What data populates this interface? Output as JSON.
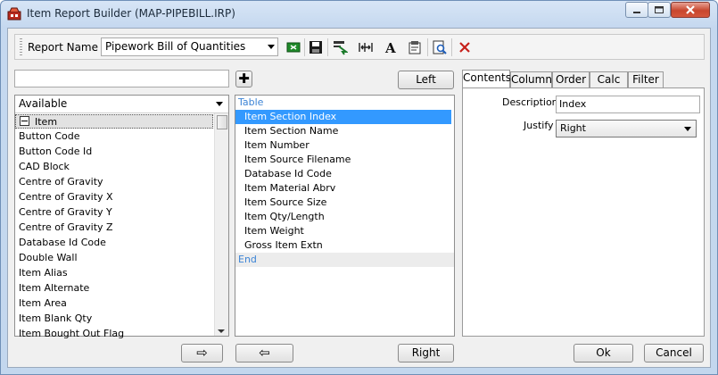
{
  "window": {
    "title": "Item Report Builder (MAP-PIPEBILL.IRP)"
  },
  "toolbar": {
    "report_name_label": "Report Name",
    "report_name_value": "Pipework Bill of Quantities",
    "icons": [
      "export-excel-icon",
      "save-icon",
      "select-icon",
      "column-width-icon",
      "font-icon",
      "properties-icon",
      "preview-icon",
      "delete-icon"
    ]
  },
  "left": {
    "filter_value": "",
    "dropdown_value": "Available",
    "items": [
      "Item",
      "Button Code",
      "Button Code Id",
      "CAD Block",
      "Centre of Gravity",
      "Centre of Gravity X",
      "Centre of Gravity Y",
      "Centre of Gravity Z",
      "Database Id Code",
      "Double Wall",
      "Item Alias",
      "Item Alternate",
      "Item Area",
      "Item Blank Qty",
      "Item Bought Out Flag"
    ],
    "add_arrow": "⇨"
  },
  "middle": {
    "left_button": "Left",
    "right_button": "Right",
    "remove_arrow": "⇦",
    "header": "Table",
    "items": [
      "Item Section Index",
      "Item Section Name",
      "Item Number",
      "Item Source Filename",
      "Database Id Code",
      "Item Material Abrv",
      "Item Source Size",
      "Item Qty/Length",
      "Item Weight",
      "Gross Item Extn"
    ],
    "footer": "End"
  },
  "right": {
    "tabs": [
      "Contents",
      "Column",
      "Order",
      "Calc",
      "Filter"
    ],
    "description_label": "Description",
    "description_value": "Index",
    "justify_label": "Justify",
    "justify_value": "Right"
  },
  "footer": {
    "ok_label": "Ok",
    "cancel_label": "Cancel"
  },
  "colors": {
    "selection": "#3399ff",
    "header_blue": "#3c84d6",
    "end_bg": "#ececec"
  }
}
